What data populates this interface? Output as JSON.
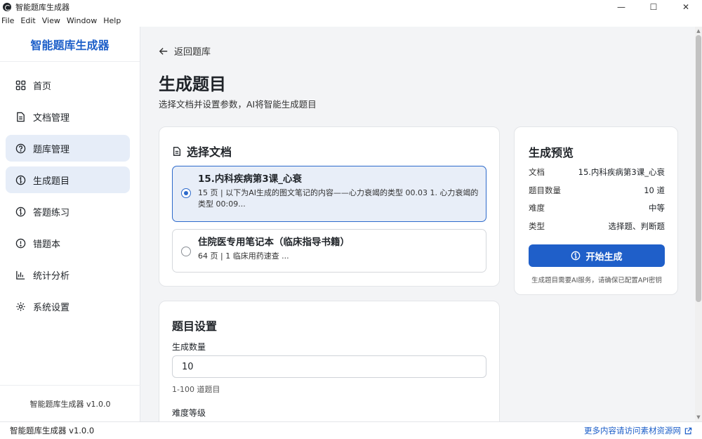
{
  "window": {
    "title": "智能题库生成器",
    "controls": {
      "minimize": "—",
      "maximize": "☐",
      "close": "✕"
    }
  },
  "menu": [
    "File",
    "Edit",
    "View",
    "Window",
    "Help"
  ],
  "sidebar": {
    "brand": "智能题库生成器",
    "items": [
      {
        "label": "首页",
        "icon": "grid-icon"
      },
      {
        "label": "文档管理",
        "icon": "document-icon"
      },
      {
        "label": "题库管理",
        "icon": "question-circle-icon"
      },
      {
        "label": "生成题目",
        "icon": "bulb-icon"
      },
      {
        "label": "答题练习",
        "icon": "bulb-icon"
      },
      {
        "label": "错题本",
        "icon": "alert-circle-icon"
      },
      {
        "label": "统计分析",
        "icon": "bar-chart-icon"
      },
      {
        "label": "系统设置",
        "icon": "gear-icon"
      }
    ],
    "active_items": [
      "题库管理",
      "生成题目"
    ],
    "footer": "智能题库生成器 v1.0.0"
  },
  "main": {
    "back_label": "返回题库",
    "title": "生成题目",
    "subtitle": "选择文档并设置参数，AI将智能生成题目",
    "doc_card": {
      "title": "选择文档",
      "options": [
        {
          "name": "15.内科疾病第3课_心衰",
          "desc": "15 页 | 以下为AI生成的图文笔记的内容——心力衰竭的类型 00.03 1. 心力衰竭的类型 00:09...",
          "selected": true
        },
        {
          "name": "住院医专用笔记本（临床指导书籍）",
          "desc": "64 页 | 1 临床用药速查 ...",
          "selected": false
        }
      ]
    },
    "settings_card": {
      "title": "题目设置",
      "count_label": "生成数量",
      "count_value": "10",
      "count_hint": "1-100 道题目",
      "difficulty_label": "难度等级"
    },
    "preview_card": {
      "title": "生成预览",
      "rows": [
        {
          "key": "文档",
          "value": "15.内科疾病第3课_心衰"
        },
        {
          "key": "题目数量",
          "value": "10 道"
        },
        {
          "key": "难度",
          "value": "中等"
        },
        {
          "key": "类型",
          "value": "选择题、判断题"
        }
      ],
      "button": "开始生成",
      "note": "生成题目需要AI服务，请确保已配置API密钥"
    }
  },
  "statusbar": {
    "left": "智能题库生成器 v1.0.0",
    "link": "更多内容请访问素材资源网"
  },
  "colors": {
    "accent": "#1f5fc9",
    "brand_text": "#1d5fc9",
    "active_nav_bg": "#e6edf8",
    "selected_option_bg": "#e8eef8"
  }
}
